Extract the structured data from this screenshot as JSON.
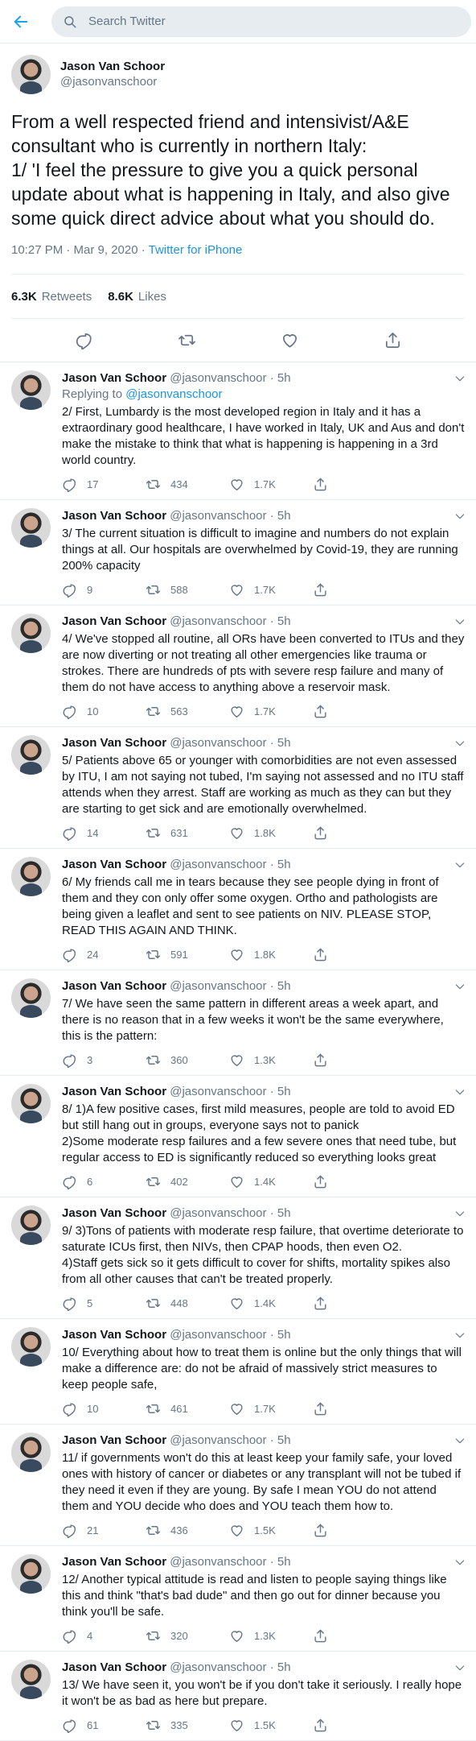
{
  "search": {
    "placeholder": "Search Twitter"
  },
  "focus_tweet": {
    "name": "Jason Van Schoor",
    "handle": "@jasonvanschoor",
    "text": "From a well respected friend and intensivist/A&E consultant who is currently in northern Italy:\n1/ 'I feel the pressure to give you a quick personal update about what is happening in Italy, and also give some quick direct advice about what you should do.",
    "time": "10:27 PM · Mar 9, 2020 · ",
    "via": "Twitter for iPhone",
    "retweets_count": "6.3K",
    "retweets_label": "Retweets",
    "likes_count": "8.6K",
    "likes_label": "Likes"
  },
  "icons": {
    "back": "arrow-left-icon",
    "search": "search-icon",
    "reply": "reply-icon",
    "retweet": "retweet-icon",
    "like": "heart-icon",
    "share": "share-icon",
    "more": "chevron-down-icon"
  },
  "colors": {
    "accent": "#1da1f2",
    "link": "#1b95e0",
    "muted": "#657786",
    "border": "#e6ecf0"
  },
  "replies": [
    {
      "name": "Jason Van Schoor",
      "handle": "@jasonvanschoor",
      "time": "· 5h",
      "replying_prefix": "Replying to ",
      "replying_to": "@jasonvanschoor",
      "text": "2/ First, Lumbardy is the most developed region in Italy and it has a extraordinary good healthcare, I have worked in Italy, UK and Aus and don't make the mistake to think that what is happening is happening in a 3rd world country.",
      "replies": "17",
      "retweets": "434",
      "likes": "1.7K"
    },
    {
      "name": "Jason Van Schoor",
      "handle": "@jasonvanschoor",
      "time": "· 5h",
      "text": "3/ The current situation is difficult to imagine and numbers do not explain things at all. Our hospitals are overwhelmed by Covid-19, they are running 200% capacity",
      "replies": "9",
      "retweets": "588",
      "likes": "1.7K"
    },
    {
      "name": "Jason Van Schoor",
      "handle": "@jasonvanschoor",
      "time": "· 5h",
      "text": "4/ We've stopped all routine, all ORs have been converted to ITUs and they are now diverting or not treating all other emergencies like trauma or strokes. There are hundreds of pts with severe resp failure and many of them do not have access to anything above a reservoir mask.",
      "replies": "10",
      "retweets": "563",
      "likes": "1.7K"
    },
    {
      "name": "Jason Van Schoor",
      "handle": "@jasonvanschoor",
      "time": "· 5h",
      "text": "5/ Patients above 65 or younger with comorbidities are not even assessed by ITU, I am not saying not tubed, I'm saying not assessed and no ITU staff attends when they arrest. Staff are working as much as they can but they are starting to get sick and are emotionally overwhelmed.",
      "replies": "14",
      "retweets": "631",
      "likes": "1.8K"
    },
    {
      "name": "Jason Van Schoor",
      "handle": "@jasonvanschoor",
      "time": "· 5h",
      "text": "6/ My friends call me in tears because they see people dying in front of them and they con only offer some oxygen. Ortho and pathologists are being given a leaflet and sent to see patients on NIV. PLEASE STOP, READ THIS AGAIN AND THINK.",
      "replies": "24",
      "retweets": "591",
      "likes": "1.8K"
    },
    {
      "name": "Jason Van Schoor",
      "handle": "@jasonvanschoor",
      "time": "· 5h",
      "text": "7/ We have seen the same pattern in different areas a week apart, and there is no reason that in a few weeks it won't be the same everywhere, this is the pattern:",
      "replies": "3",
      "retweets": "360",
      "likes": "1.3K"
    },
    {
      "name": "Jason Van Schoor",
      "handle": "@jasonvanschoor",
      "time": "· 5h",
      "text": "8/ 1)A few positive cases, first mild measures, people are told to avoid ED but still hang out in groups, everyone says not to panick\n2)Some moderate resp failures and a few severe ones that need tube, but regular access to ED is significantly reduced so everything looks great",
      "replies": "6",
      "retweets": "402",
      "likes": "1.4K"
    },
    {
      "name": "Jason Van Schoor",
      "handle": "@jasonvanschoor",
      "time": "· 5h",
      "text": "9/ 3)Tons of patients with moderate resp failure, that overtime deteriorate to saturate ICUs first, then NIVs, then CPAP hoods, then even O2.\n4)Staff gets sick so it gets difficult to cover for shifts, mortality spikes also from all other causes that can't be treated properly.",
      "replies": "5",
      "retweets": "448",
      "likes": "1.4K"
    },
    {
      "name": "Jason Van Schoor",
      "handle": "@jasonvanschoor",
      "time": "· 5h",
      "text": "10/ Everything about how to treat them is online but the only things that will make a difference are: do not be afraid of massively strict measures to keep people safe,",
      "replies": "10",
      "retweets": "461",
      "likes": "1.7K"
    },
    {
      "name": "Jason Van Schoor",
      "handle": "@jasonvanschoor",
      "time": "· 5h",
      "text": "11/ if governments won't do this at least keep your family safe, your loved ones with history of cancer or diabetes or any transplant will not be tubed if they need it even if they are young. By safe I mean YOU do not attend them and YOU decide who does and YOU teach them how to.",
      "replies": "21",
      "retweets": "436",
      "likes": "1.5K"
    },
    {
      "name": "Jason Van Schoor",
      "handle": "@jasonvanschoor",
      "time": "· 5h",
      "text": "12/ Another typical attitude is read and listen to people saying things like this and think \"that's bad dude\" and then go out for dinner because you think you'll be safe.",
      "replies": "4",
      "retweets": "320",
      "likes": "1.3K"
    },
    {
      "name": "Jason Van Schoor",
      "handle": "@jasonvanschoor",
      "time": "· 5h",
      "text": "13/ We have seen it, you won't be if you don't take it seriously. I really hope it won't be as bad as here but prepare.",
      "replies": "61",
      "retweets": "335",
      "likes": "1.5K"
    }
  ]
}
